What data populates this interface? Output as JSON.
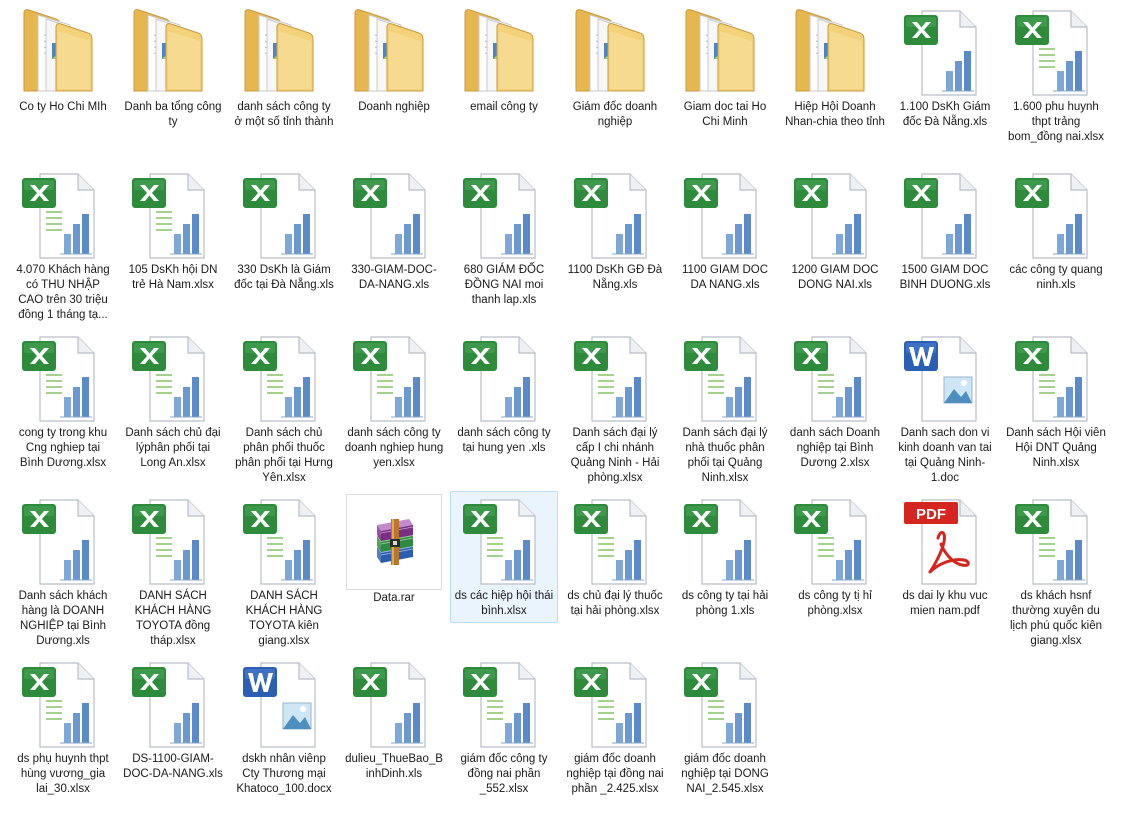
{
  "items": [
    {
      "name": "Co ty Ho Chi MIh",
      "type": "folder"
    },
    {
      "name": "Danh ba tổng công ty",
      "type": "folder"
    },
    {
      "name": "danh sách công ty ở một  số tỉnh thành",
      "type": "folder"
    },
    {
      "name": "Doanh nghiệp",
      "type": "folder"
    },
    {
      "name": "email công ty",
      "type": "folder"
    },
    {
      "name": "Giám đốc doanh nghiệp",
      "type": "folder"
    },
    {
      "name": "Giam doc tai Ho Chi Minh",
      "type": "folder"
    },
    {
      "name": "Hiệp Hội Doanh Nhan-chia theo tỉnh",
      "type": "folder"
    },
    {
      "name": "1.100 DsKh Giám đốc Đà Nẵng.xls",
      "type": "xls"
    },
    {
      "name": "1.600 phu huynh thpt trảng bom_đồng nai.xlsx",
      "type": "xlsx"
    },
    {
      "name": "4.070 Khách hàng có THU NHẬP CAO trên 30 triệu đồng 1 tháng tạ...",
      "type": "xlsx"
    },
    {
      "name": "105 DsKh hội DN trẻ Hà Nam.xlsx",
      "type": "xlsx"
    },
    {
      "name": "330 DsKh là Giám đốc tại Đà Nẵng.xls",
      "type": "xls"
    },
    {
      "name": "330-GIAM-DOC-DA-NANG.xls",
      "type": "xls"
    },
    {
      "name": "680 GIÁM ĐỐC ĐỒNG NAI moi thanh lap.xls",
      "type": "xls"
    },
    {
      "name": "1100 DsKh GĐ Đà Nẵng.xls",
      "type": "xls"
    },
    {
      "name": "1100 GIAM DOC DA NANG.xls",
      "type": "xls"
    },
    {
      "name": "1200 GIAM DOC DONG NAI.xls",
      "type": "xls"
    },
    {
      "name": "1500 GIAM DOC BINH DUONG.xls",
      "type": "xls"
    },
    {
      "name": "các công ty quang ninh.xls",
      "type": "xls"
    },
    {
      "name": "cong ty trong khu Cng nghiep tại Bình Dương.xlsx",
      "type": "xlsx"
    },
    {
      "name": "Danh sách chủ đại lýphân phối tại Long An.xlsx",
      "type": "xlsx"
    },
    {
      "name": "Danh sách chủ phân phối  thuốc phân phối tại Hưng Yên.xlsx",
      "type": "xlsx"
    },
    {
      "name": "danh sách công ty  doanh nghiep hung yen.xlsx",
      "type": "xlsx"
    },
    {
      "name": "danh sách công ty tại hung yen .xls",
      "type": "xls"
    },
    {
      "name": "Danh sách đại lý cấp I chi nhánh Quảng Ninh - Hải phòng.xlsx",
      "type": "xlsx"
    },
    {
      "name": "Danh sách đại lý nhà thuốc phân phối tại Quảng Ninh.xlsx",
      "type": "xlsx"
    },
    {
      "name": "danh sách Doanh nghiệp tại Bình Dương 2.xlsx",
      "type": "xlsx"
    },
    {
      "name": "Danh sach don vi kinh doanh van tai tại Quảng Ninh-1.doc",
      "type": "doc"
    },
    {
      "name": "Danh sách Hội viên Hội DNT Quảng Ninh.xlsx",
      "type": "xlsx"
    },
    {
      "name": "Danh sách khách hàng là DOANH NGHIỆP tại Bình Dương.xls",
      "type": "xls"
    },
    {
      "name": "DANH SÁCH KHÁCH HÀNG TOYOTA đồng tháp.xlsx",
      "type": "xlsx"
    },
    {
      "name": "DANH SÁCH KHÁCH HÀNG TOYOTA kiên giang.xlsx",
      "type": "xlsx"
    },
    {
      "name": "Data.rar",
      "type": "rar"
    },
    {
      "name": "ds các hiệp hội thái bình.xlsx",
      "type": "xlsx",
      "selected": true
    },
    {
      "name": "ds chủ đại lý thuốc tại hải phòng.xlsx",
      "type": "xlsx"
    },
    {
      "name": "ds công ty tại hải phòng 1.xls",
      "type": "xls"
    },
    {
      "name": "ds công ty tị hỉ phòng.xlsx",
      "type": "xlsx"
    },
    {
      "name": "ds dai ly khu vuc mien nam.pdf",
      "type": "pdf"
    },
    {
      "name": "ds khách hsnf thường xuyên du lịch phú quốc kiên giang.xlsx",
      "type": "xlsx"
    },
    {
      "name": "ds phụ huynh thpt hùng vương_gia lai_30.xlsx",
      "type": "xlsx"
    },
    {
      "name": "DS-1100-GIAM-DOC-DA-NANG.xls",
      "type": "xls"
    },
    {
      "name": "dskh nhân viênp Cty Thương mại Khatoco_100.docx",
      "type": "docx"
    },
    {
      "name": "dulieu_ThueBao_BinhDinh.xls",
      "type": "xls"
    },
    {
      "name": "giám đốc công ty đồng nai phần _552.xlsx",
      "type": "xlsx"
    },
    {
      "name": "giám đốc doanh nghiệp tại đồng nai phần _2.425.xlsx",
      "type": "xlsx"
    },
    {
      "name": "giám đốc doanh nghiệp tại DONG NAI_2.545.xlsx",
      "type": "xlsx"
    }
  ],
  "icons": {
    "folder": "folder-icon",
    "xls": "excel-xls-icon",
    "xlsx": "excel-xlsx-icon",
    "doc": "word-doc-icon",
    "docx": "word-docx-icon",
    "pdf": "pdf-icon",
    "rar": "rar-archive-icon"
  },
  "colors": {
    "excel_green": "#2e8b3c",
    "word_blue": "#2b5fb4",
    "pdf_red": "#d4261f",
    "folder_yellow": "#f3d27a",
    "selection_bg": "#eaf4fd",
    "selection_border": "#bcdcf5"
  }
}
